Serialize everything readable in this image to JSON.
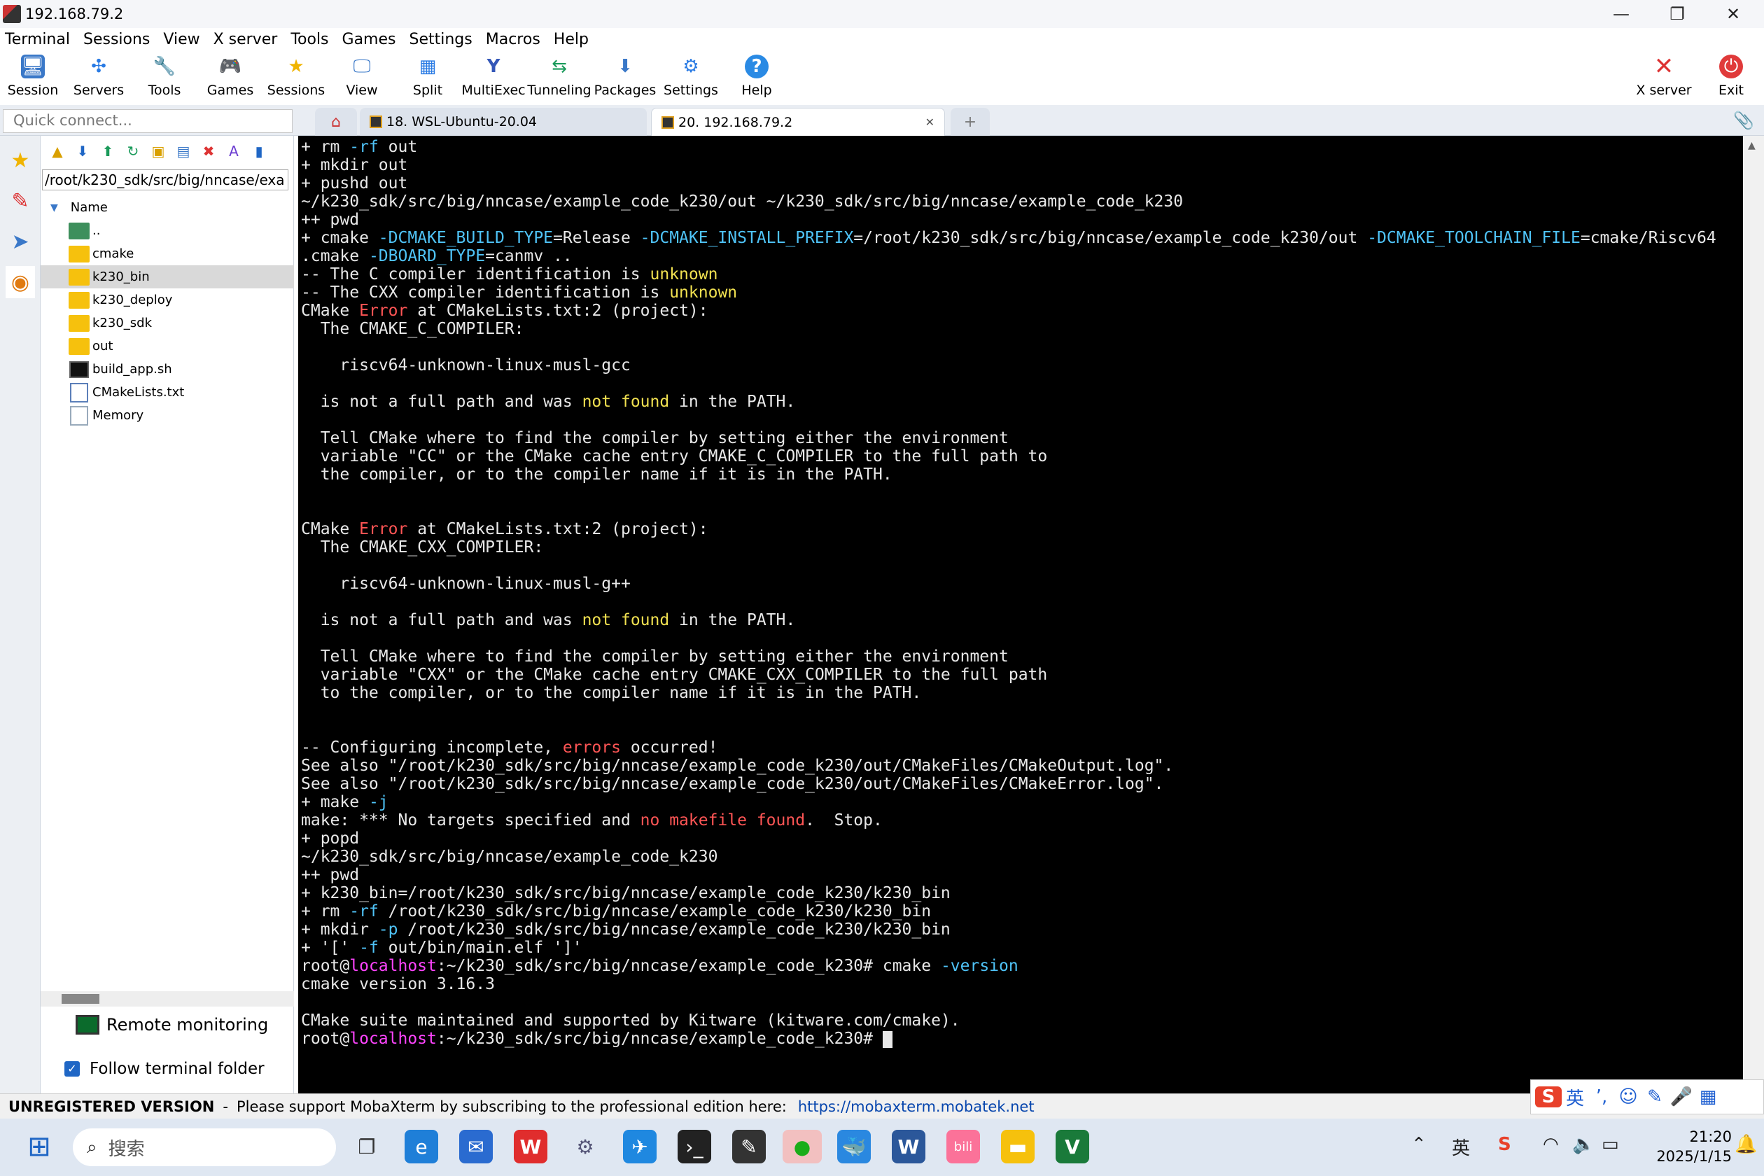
{
  "window": {
    "title": "192.168.79.2",
    "minimize": "—",
    "restore": "❐",
    "close": "✕"
  },
  "menu": [
    "Terminal",
    "Sessions",
    "View",
    "X server",
    "Tools",
    "Games",
    "Settings",
    "Macros",
    "Help"
  ],
  "toolbar": {
    "items": [
      {
        "label": "Session",
        "icon": "monitor-icon",
        "glyph": "🖥"
      },
      {
        "label": "Servers",
        "icon": "servers-icon",
        "glyph": "✣"
      },
      {
        "label": "Tools",
        "icon": "tools-icon",
        "glyph": "🔧"
      },
      {
        "label": "Games",
        "icon": "games-icon",
        "glyph": "🎮"
      },
      {
        "label": "Sessions",
        "icon": "star-icon",
        "glyph": "★"
      },
      {
        "label": "View",
        "icon": "view-icon",
        "glyph": "🖵"
      },
      {
        "label": "Split",
        "icon": "split-icon",
        "glyph": "▦"
      },
      {
        "label": "MultiExec",
        "icon": "multiexec-icon",
        "glyph": "Y"
      },
      {
        "label": "Tunneling",
        "icon": "tunneling-icon",
        "glyph": "⇆"
      },
      {
        "label": "Packages",
        "icon": "packages-icon",
        "glyph": "⬇"
      },
      {
        "label": "Settings",
        "icon": "gear-icon",
        "glyph": "⚙"
      },
      {
        "label": "Help",
        "icon": "help-icon",
        "glyph": "?"
      }
    ],
    "xserver_label": "X server",
    "exit_label": "Exit"
  },
  "quick_connect": {
    "placeholder": "Quick connect..."
  },
  "tabs": [
    {
      "label": "18. WSL-Ubuntu-20.04",
      "active": false
    },
    {
      "label": "20. 192.168.79.2",
      "active": true
    }
  ],
  "tab_close": "✕",
  "sidebar": {
    "path": "/root/k230_sdk/src/big/nncase/exa",
    "column": "Name",
    "items": [
      {
        "name": "..",
        "type": "up"
      },
      {
        "name": "cmake",
        "type": "folder"
      },
      {
        "name": "k230_bin",
        "type": "folder",
        "selected": true
      },
      {
        "name": "k230_deploy",
        "type": "folder"
      },
      {
        "name": "k230_sdk",
        "type": "folder"
      },
      {
        "name": "out",
        "type": "folder"
      },
      {
        "name": "build_app.sh",
        "type": "script"
      },
      {
        "name": "CMakeLists.txt",
        "type": "text"
      },
      {
        "name": "Memory",
        "type": "file"
      }
    ],
    "remote_monitoring": "Remote monitoring",
    "follow_terminal": "Follow terminal folder"
  },
  "terminal": {
    "lines": [
      [
        {
          "t": "+ rm "
        },
        {
          "t": "-rf",
          "c": "c"
        },
        {
          "t": " out"
        }
      ],
      [
        {
          "t": "+ mkdir out"
        }
      ],
      [
        {
          "t": "+ pushd out"
        }
      ],
      [
        {
          "t": "~/k230_sdk/src/big/nncase/example_code_k230/out ~/k230_sdk/src/big/nncase/example_code_k230"
        }
      ],
      [
        {
          "t": "++ pwd"
        }
      ],
      [
        {
          "t": "+ cmake "
        },
        {
          "t": "-DCMAKE_BUILD_TYPE",
          "c": "c"
        },
        {
          "t": "=Release "
        },
        {
          "t": "-DCMAKE_INSTALL_PREFIX",
          "c": "c"
        },
        {
          "t": "=/root/k230_sdk/src/big/nncase/example_code_k230/out "
        },
        {
          "t": "-DCMAKE_TOOLCHAIN_FILE",
          "c": "c"
        },
        {
          "t": "=cmake/Riscv64"
        }
      ],
      [
        {
          "t": ".cmake "
        },
        {
          "t": "-DBOARD_TYPE",
          "c": "c"
        },
        {
          "t": "=canmv .."
        }
      ],
      [
        {
          "t": "-- The C compiler identification is "
        },
        {
          "t": "unknown",
          "c": "y"
        }
      ],
      [
        {
          "t": "-- The CXX compiler identification is "
        },
        {
          "t": "unknown",
          "c": "y"
        }
      ],
      [
        {
          "t": "CMake "
        },
        {
          "t": "Error",
          "c": "r"
        },
        {
          "t": " at CMakeLists.txt:2 (project):"
        }
      ],
      [
        {
          "t": "  The CMAKE_C_COMPILER:"
        }
      ],
      [
        {
          "t": ""
        }
      ],
      [
        {
          "t": "    riscv64-unknown-linux-musl-gcc"
        }
      ],
      [
        {
          "t": ""
        }
      ],
      [
        {
          "t": "  is not a full path and was "
        },
        {
          "t": "not found",
          "c": "y"
        },
        {
          "t": " in the PATH."
        }
      ],
      [
        {
          "t": ""
        }
      ],
      [
        {
          "t": "  Tell CMake where to find the compiler by setting either the environment"
        }
      ],
      [
        {
          "t": "  variable \"CC\" or the CMake cache entry CMAKE_C_COMPILER to the full path to"
        }
      ],
      [
        {
          "t": "  the compiler, or to the compiler name if it is in the PATH."
        }
      ],
      [
        {
          "t": ""
        }
      ],
      [
        {
          "t": ""
        }
      ],
      [
        {
          "t": "CMake "
        },
        {
          "t": "Error",
          "c": "r"
        },
        {
          "t": " at CMakeLists.txt:2 (project):"
        }
      ],
      [
        {
          "t": "  The CMAKE_CXX_COMPILER:"
        }
      ],
      [
        {
          "t": ""
        }
      ],
      [
        {
          "t": "    riscv64-unknown-linux-musl-g++"
        }
      ],
      [
        {
          "t": ""
        }
      ],
      [
        {
          "t": "  is not a full path and was "
        },
        {
          "t": "not found",
          "c": "y"
        },
        {
          "t": " in the PATH."
        }
      ],
      [
        {
          "t": ""
        }
      ],
      [
        {
          "t": "  Tell CMake where to find the compiler by setting either the environment"
        }
      ],
      [
        {
          "t": "  variable \"CXX\" or the CMake cache entry CMAKE_CXX_COMPILER to the full path"
        }
      ],
      [
        {
          "t": "  to the compiler, or to the compiler name if it is in the PATH."
        }
      ],
      [
        {
          "t": ""
        }
      ],
      [
        {
          "t": ""
        }
      ],
      [
        {
          "t": "-- Configuring incomplete, "
        },
        {
          "t": "errors",
          "c": "r"
        },
        {
          "t": " occurred!"
        }
      ],
      [
        {
          "t": "See also \"/root/k230_sdk/src/big/nncase/example_code_k230/out/CMakeFiles/CMakeOutput.log\"."
        }
      ],
      [
        {
          "t": "See also \"/root/k230_sdk/src/big/nncase/example_code_k230/out/CMakeFiles/CMakeError.log\"."
        }
      ],
      [
        {
          "t": "+ make "
        },
        {
          "t": "-j",
          "c": "c"
        }
      ],
      [
        {
          "t": "make: *** No targets specified and "
        },
        {
          "t": "no makefile found",
          "c": "r"
        },
        {
          "t": ".  Stop."
        }
      ],
      [
        {
          "t": "+ popd"
        }
      ],
      [
        {
          "t": "~/k230_sdk/src/big/nncase/example_code_k230"
        }
      ],
      [
        {
          "t": "++ pwd"
        }
      ],
      [
        {
          "t": "+ k230_bin=/root/k230_sdk/src/big/nncase/example_code_k230/k230_bin"
        }
      ],
      [
        {
          "t": "+ rm "
        },
        {
          "t": "-rf",
          "c": "c"
        },
        {
          "t": " /root/k230_sdk/src/big/nncase/example_code_k230/k230_bin"
        }
      ],
      [
        {
          "t": "+ mkdir "
        },
        {
          "t": "-p",
          "c": "c"
        },
        {
          "t": " /root/k230_sdk/src/big/nncase/example_code_k230/k230_bin"
        }
      ],
      [
        {
          "t": "+ '[' "
        },
        {
          "t": "-f",
          "c": "c"
        },
        {
          "t": " out/bin/main.elf ']'"
        }
      ],
      [
        {
          "t": "root@"
        },
        {
          "t": "localhost",
          "c": "m"
        },
        {
          "t": ":~/k230_sdk/src/big/nncase/example_code_k230# cmake "
        },
        {
          "t": "-version",
          "c": "c"
        }
      ],
      [
        {
          "t": "cmake version 3.16.3"
        }
      ],
      [
        {
          "t": ""
        }
      ],
      [
        {
          "t": "CMake suite maintained and supported by Kitware (kitware.com/cmake)."
        }
      ],
      [
        {
          "t": "root@"
        },
        {
          "t": "localhost",
          "c": "m"
        },
        {
          "t": ":~/k230_sdk/src/big/nncase/example_code_k230# "
        },
        {
          "t": "",
          "cursor": true
        }
      ]
    ]
  },
  "status": {
    "unregistered": "UNREGISTERED VERSION",
    "sep": "-",
    "message": "Please support MobaXterm by subscribing to the professional edition here:",
    "link": "https://mobaxterm.mobatek.net"
  },
  "ime": {
    "lang": "英"
  },
  "taskbar": {
    "search_placeholder": "搜索",
    "time": "21:20",
    "date": "2025/1/15"
  },
  "colors": {
    "accent": "#1f66c5",
    "terminal_bg": "#000000",
    "yellow": "#f0e050",
    "red": "#ff5555",
    "cyan": "#4fc3f7",
    "magenta": "#ff44ff"
  }
}
